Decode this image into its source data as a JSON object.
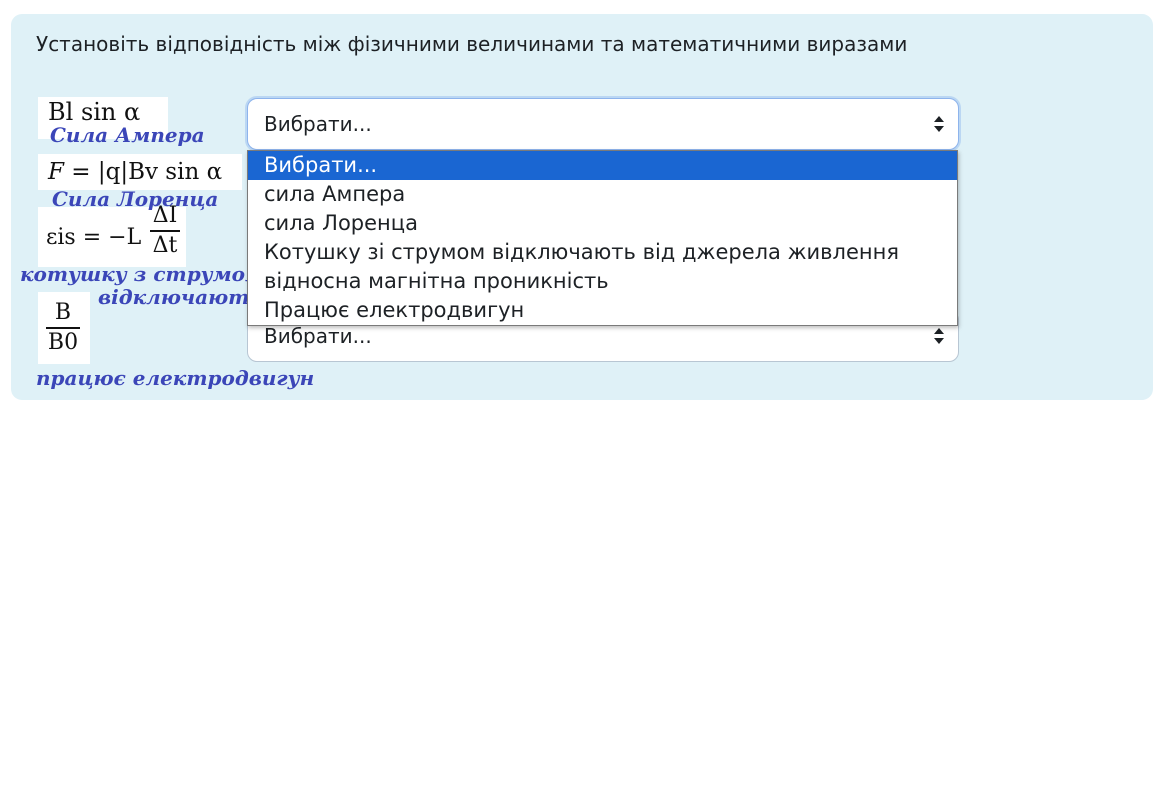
{
  "question": "Установіть відповідність між фізичними величинами та математичними виразами",
  "formulas": {
    "f1": "Bl sin α",
    "f2_lhs": "F",
    "f2_rhs": " = |q|Bv sin α",
    "f3_lhs": "εis = −L",
    "f3_num": "ΔI",
    "f3_den": "Δt",
    "f4_num": "B",
    "f4_den": "B0"
  },
  "handwritten": {
    "n1": "Сила Ампера",
    "n2": "Сила Лоренца",
    "n3a": "котушку з струмом",
    "n3b": "відключають",
    "n4": "працює електродвигун"
  },
  "selects": {
    "first_value": "Вибрати...",
    "last_value": "Вибрати..."
  },
  "dropdown": {
    "options": [
      "Вибрати...",
      "сила Ампера",
      "сила Лоренца",
      "Котушку зі струмом відключають від джерела живлення",
      "відносна магнітна проникність",
      "Працює електродвигун"
    ],
    "selected_index": 0
  },
  "colors": {
    "card_bg": "#dff1f7",
    "highlight": "#1a66d2",
    "handwriting": "#3b46b8"
  }
}
